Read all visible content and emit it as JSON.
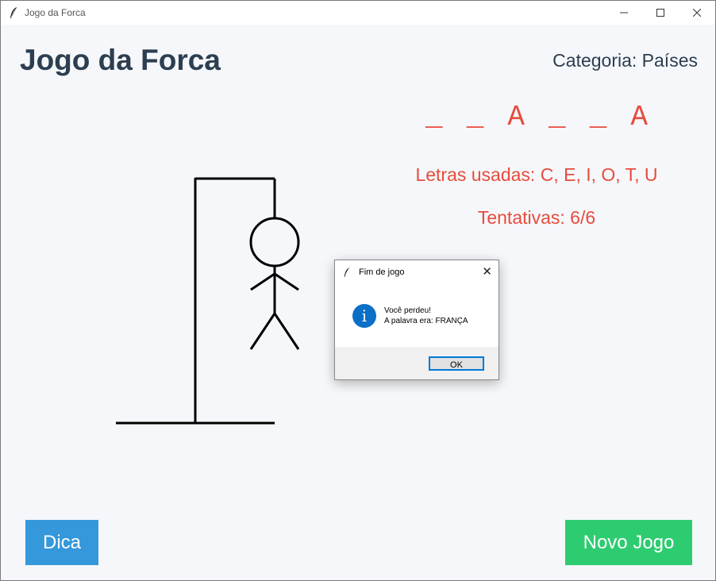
{
  "window": {
    "title": "Jogo da Forca"
  },
  "header": {
    "title": "Jogo da Forca",
    "category": "Categoria: Países"
  },
  "word": {
    "letters": [
      "_",
      "_",
      "A",
      "_",
      "_",
      "A"
    ]
  },
  "status": {
    "used_letters": "Letras usadas: C, E, I, O, T, U",
    "attempts": "Tentativas: 6/6"
  },
  "buttons": {
    "hint": "Dica",
    "new_game": "Novo Jogo"
  },
  "dialog": {
    "title": "Fim de jogo",
    "line1": "Você perdeu!",
    "line2": "A palavra era: FRANÇA",
    "ok": "OK"
  },
  "colors": {
    "accent_red": "#e74c3c",
    "title_dark": "#2c3e50",
    "hint_blue": "#3498db",
    "new_green": "#2ecc71"
  }
}
